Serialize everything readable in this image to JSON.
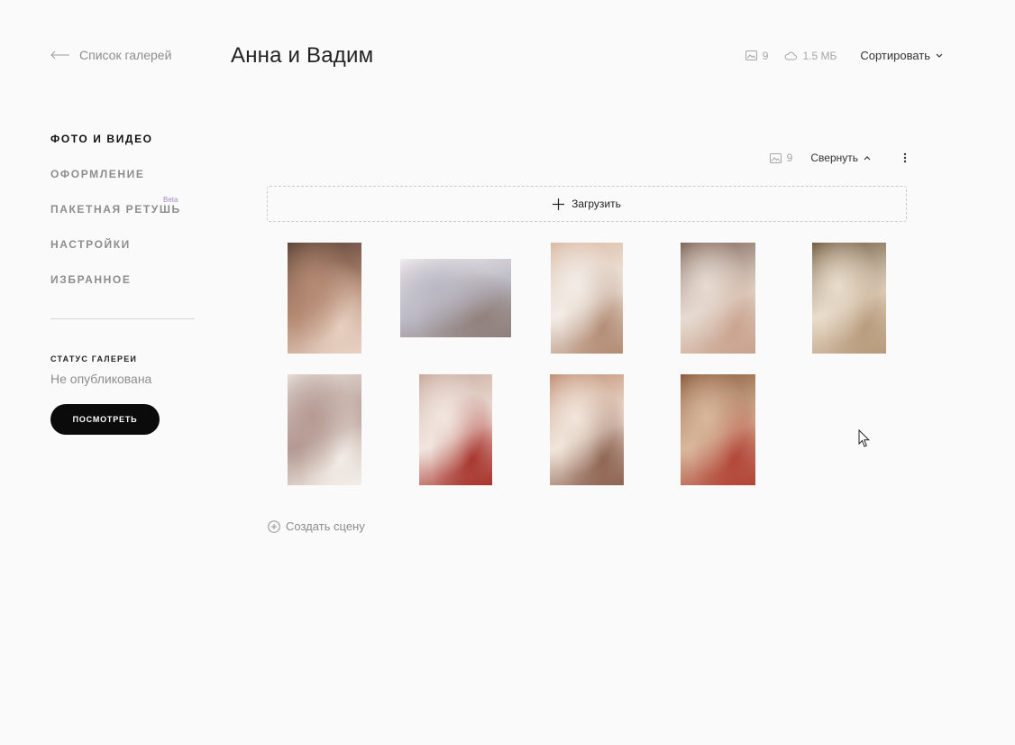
{
  "header": {
    "back_label": "Список галерей",
    "title": "Анна и Вадим",
    "photo_count": "9",
    "storage": "1.5 МБ",
    "sort_label": "Сортировать"
  },
  "sidebar": {
    "items": [
      {
        "label": "ФОТО И ВИДЕО",
        "active": true
      },
      {
        "label": "ОФОРМЛЕНИЕ",
        "active": false
      },
      {
        "label": "ПАКЕТНАЯ РЕТУШЬ",
        "active": false,
        "badge": "Beta"
      },
      {
        "label": "НАСТРОЙКИ",
        "active": false
      },
      {
        "label": "ИЗБРАННОЕ",
        "active": false
      }
    ],
    "status_heading": "СТАТУС ГАЛЕРЕИ",
    "status_value": "Не опубликована",
    "view_button": "ПОСМОТРЕТЬ"
  },
  "scene": {
    "photo_count": "9",
    "collapse_label": "Свернуть",
    "upload_label": "Загрузить",
    "create_scene_label": "Создать сцену",
    "photos": [
      {
        "name": "photo-wedding-table",
        "colors": [
          "#5b4336",
          "#b58a73",
          "#e8d2c3"
        ]
      },
      {
        "name": "photo-shoes-on-table",
        "colors": [
          "#f1eeee",
          "#b9b7c2",
          "#8f7f7a"
        ]
      },
      {
        "name": "photo-dress-lacing",
        "colors": [
          "#d9b9a2",
          "#f2ece6",
          "#b28b73"
        ]
      },
      {
        "name": "photo-bride-mirror",
        "colors": [
          "#7e6256",
          "#e6dbd1",
          "#c9a38e"
        ]
      },
      {
        "name": "photo-bride-portrait",
        "colors": [
          "#6f5a3e",
          "#e9dccb",
          "#b79a7b"
        ]
      },
      {
        "name": "photo-bride-window",
        "colors": [
          "#e7ddd9",
          "#b49a92",
          "#f4efe9"
        ]
      },
      {
        "name": "photo-red-shoes",
        "colors": [
          "#c8a89c",
          "#f1e6df",
          "#a6332b"
        ]
      },
      {
        "name": "photo-dress-back",
        "colors": [
          "#c08d73",
          "#f1e5da",
          "#8d6250"
        ]
      },
      {
        "name": "photo-mirror-stand",
        "colors": [
          "#8a5a3d",
          "#d8b79b",
          "#b14436"
        ]
      }
    ]
  },
  "colors": {
    "background": "#fafafa",
    "accent_badge": "#9f8cc9",
    "button_bg": "#0b0b0b"
  }
}
